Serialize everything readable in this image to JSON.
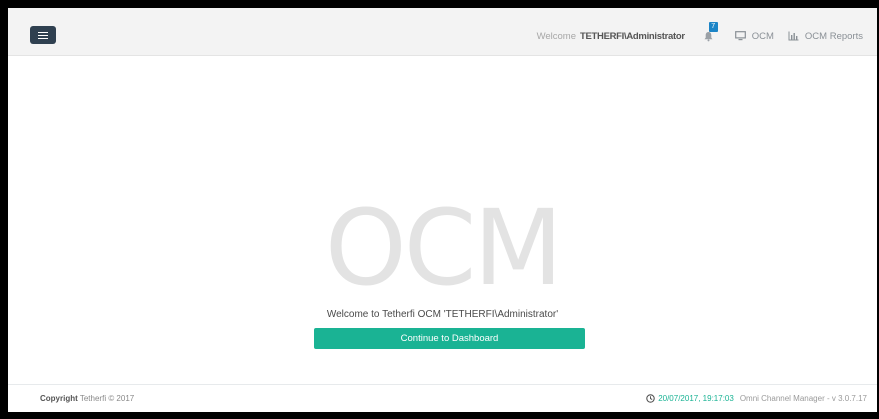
{
  "header": {
    "menu_icon": "hamburger-icon",
    "welcome_prefix": "Welcome",
    "username": "TETHERFI\\Administrator",
    "notification_count": "7",
    "nav": [
      {
        "label": "OCM",
        "icon": "monitor-icon"
      },
      {
        "label": "OCM Reports",
        "icon": "bar-chart-icon"
      }
    ]
  },
  "main": {
    "hero_text": "OCM",
    "welcome_message": "Welcome to Tetherfi OCM 'TETHERFI\\Administrator'",
    "continue_label": "Continue to Dashboard"
  },
  "footer": {
    "copyright_label": "Copyright",
    "copyright_text": "Tetherfi © 2017",
    "timestamp": "20/07/2017, 19:17:03",
    "app_version": "Omni Channel Manager - v 3.0.7.17"
  },
  "colors": {
    "accent": "#1ab394",
    "menu_button": "#2f4050",
    "badge": "#1c84c6"
  }
}
